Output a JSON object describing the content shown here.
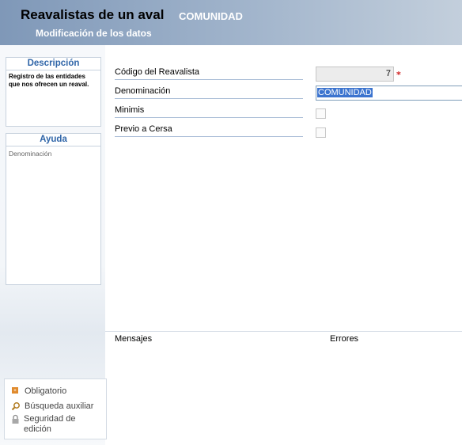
{
  "header": {
    "title": "Reavalistas de un aval",
    "record": "COMUNIDAD",
    "subtitle": "Modificación de los datos"
  },
  "sidebar": {
    "description": {
      "title": "Descripción",
      "text": "Registro de las entidades que nos ofrecen un reaval."
    },
    "help": {
      "title": "Ayuda",
      "text": "Denominación"
    },
    "legend": {
      "required": "Obligatorio",
      "search": "Búsqueda auxiliar",
      "security": "Seguridad de edición"
    }
  },
  "form": {
    "codigo": {
      "label": "Código del Reavalista",
      "value": "7",
      "required_mark": "*"
    },
    "denominacion": {
      "label": "Denominación",
      "value": "COMUNIDAD"
    },
    "minimis": {
      "label": "Minimis",
      "checked": false
    },
    "previo": {
      "label": "Previo a Cersa",
      "checked": false
    }
  },
  "footer": {
    "messages": "Mensajes",
    "errors": "Errores"
  },
  "colors": {
    "accent": "#2f65a8",
    "header_start": "#7f98b8",
    "selection": "#3c74cf",
    "required": "#d02020"
  }
}
